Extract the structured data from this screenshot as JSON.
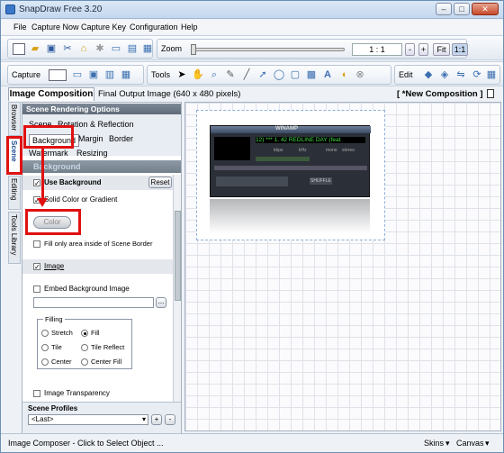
{
  "window": {
    "title": "SnapDraw Free 3.20"
  },
  "menu": [
    "File",
    "Capture Now",
    "Capture Key",
    "Configuration",
    "Help"
  ],
  "toolbar": {
    "zoom_label": "Zoom",
    "zoom_ratio": "1 : 1",
    "zoom_minus": "-",
    "zoom_plus": "+",
    "fit": "Fit",
    "one_to_one": "1:1",
    "capture_label": "Capture",
    "tools_label": "Tools",
    "edit_label": "Edit",
    "text_tool": "A"
  },
  "tabs": {
    "composition": "Image Composition",
    "final": "Final Output Image (640 x 480 pixels)",
    "new_comp": "[ *New Composition ]"
  },
  "vtabs": [
    "Browser",
    "Scene",
    "Editing",
    "Tools Library"
  ],
  "panel": {
    "header": "Scene Rendering Options",
    "subtabs": [
      "Scene",
      "Rotation & Reflection",
      "Background",
      "Margin",
      "Border",
      "Watermark",
      "Resizing"
    ],
    "section": "Background",
    "use_background": "Use Background",
    "reset": "Reset",
    "solid": "Solid Color or Gradient",
    "color_btn": "Color",
    "fill_only": "Fill only area inside of Scene Border",
    "image": "Image",
    "embed": "Embed Background Image",
    "browse": "...",
    "filling": "Filling",
    "fill_opts": [
      "Stretch",
      "Fill",
      "Tile",
      "Tile Reflect",
      "Center",
      "Center Fill"
    ],
    "transparency": "Image Transparency",
    "profiles": "Scene Profiles",
    "last": "<Last>",
    "add": "+",
    "remove": "-"
  },
  "winamp": {
    "title": "WINAMP",
    "track": "12) *** 1. 42 REDLINE DAY (feat",
    "kbps": "kbps",
    "khz": "kHz",
    "mono": "mono",
    "stereo": "stereo",
    "shuffle": "SHUFFLE"
  },
  "status": {
    "left": "Image Composer - Click to Select Object ...",
    "skins": "Skins",
    "canvas": "Canvas"
  }
}
